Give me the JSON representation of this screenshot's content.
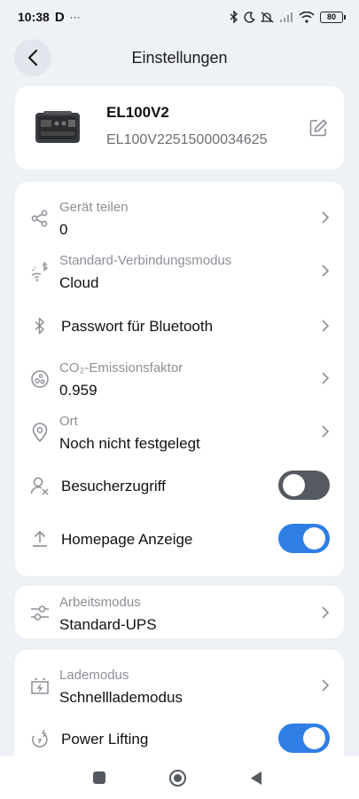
{
  "status_bar": {
    "time": "10:38",
    "app_letter": "D",
    "dots": "···",
    "battery": "80"
  },
  "header": {
    "title": "Einstellungen"
  },
  "device": {
    "name": "EL100V2",
    "serial": "EL100V22515000034625"
  },
  "settings": {
    "share": {
      "label": "Gerät teilen",
      "value": "0"
    },
    "connection": {
      "label": "Standard-Verbindungsmodus",
      "value": "Cloud"
    },
    "bluetooth_password": {
      "label": "Passwort für Bluetooth"
    },
    "co2": {
      "label": "CO₂-Emissionsfaktor",
      "value": "0.959"
    },
    "location": {
      "label": "Ort",
      "value": "Noch nicht festgelegt"
    },
    "visitor": {
      "label": "Besucherzugriff",
      "enabled": false
    },
    "homepage": {
      "label": "Homepage Anzeige",
      "enabled": true
    }
  },
  "work_mode": {
    "label": "Arbeitsmodus",
    "value": "Standard-UPS"
  },
  "charging": {
    "mode": {
      "label": "Lademodus",
      "value": "Schnelllademodus"
    },
    "power_lifting": {
      "label": "Power Lifting",
      "enabled": true
    }
  },
  "colors": {
    "accent": "#2f7ee6",
    "toggle_off": "#555a60",
    "background": "#eef1f5"
  }
}
